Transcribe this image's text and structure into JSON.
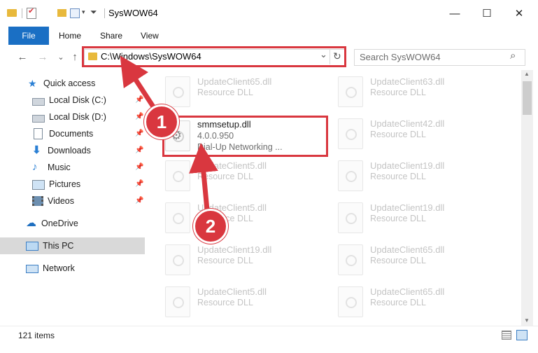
{
  "window": {
    "title": "SysWOW64",
    "minimize_glyph": "—",
    "maximize_glyph": "☐",
    "close_glyph": "✕"
  },
  "ribbon": {
    "tabs": [
      {
        "label": "File"
      },
      {
        "label": "Home"
      },
      {
        "label": "Share"
      },
      {
        "label": "View"
      }
    ]
  },
  "nav": {
    "back_glyph": "←",
    "forward_glyph": "→",
    "recent_glyph": "⌄",
    "up_glyph": "↑",
    "address": "C:\\Windows\\SysWOW64",
    "address_dropdown_glyph": "⌄",
    "refresh_glyph": "↻",
    "search_placeholder": "Search SysWOW64",
    "search_glyph": "⌕"
  },
  "sidebar": {
    "items": [
      {
        "label": "Quick access",
        "icon": "star-icon"
      },
      {
        "label": "Local Disk (C:)",
        "icon": "drive-icon",
        "pinned": true
      },
      {
        "label": "Local Disk (D:)",
        "icon": "drive-icon",
        "pinned": true
      },
      {
        "label": "Documents",
        "icon": "document-icon",
        "pinned": true
      },
      {
        "label": "Downloads",
        "icon": "download-icon",
        "pinned": true
      },
      {
        "label": "Music",
        "icon": "music-icon",
        "pinned": true
      },
      {
        "label": "Pictures",
        "icon": "pictures-icon",
        "pinned": true
      },
      {
        "label": "Videos",
        "icon": "video-icon",
        "pinned": true
      },
      {
        "label": "OneDrive",
        "icon": "cloud-icon"
      },
      {
        "label": "This PC",
        "icon": "computer-icon",
        "selected": true
      },
      {
        "label": "Network",
        "icon": "network-icon"
      }
    ],
    "pin_glyph": "📌"
  },
  "files": {
    "col1": [
      {
        "name": "UpdateClient65.dll",
        "type": "Resource DLL"
      },
      {
        "name": "smmsetup.dll",
        "version": "4.0.0.950",
        "desc": "Dial-Up Networking ..."
      },
      {
        "name": "UpdateClient5.dll",
        "type": "Resource DLL"
      },
      {
        "name": "UpdateClient5.dll",
        "type": "Resource DLL"
      },
      {
        "name": "UpdateClient19.dll",
        "type": "Resource DLL"
      },
      {
        "name": "UpdateClient5.dll",
        "type": "Resource DLL"
      }
    ],
    "col2": [
      {
        "name": "UpdateClient63.dll",
        "type": "Resource DLL"
      },
      {
        "name": "UpdateClient42.dll",
        "type": "Resource DLL"
      },
      {
        "name": "UpdateClient19.dll",
        "type": "Resource DLL"
      },
      {
        "name": "UpdateClient19.dll",
        "type": "Resource DLL"
      },
      {
        "name": "UpdateClient65.dll",
        "type": "Resource DLL"
      },
      {
        "name": "UpdateClient65.dll",
        "type": "Resource DLL"
      }
    ]
  },
  "status": {
    "item_count": "121 items"
  },
  "annotations": {
    "step1": "1",
    "step2": "2",
    "accent": "#d9373f"
  }
}
